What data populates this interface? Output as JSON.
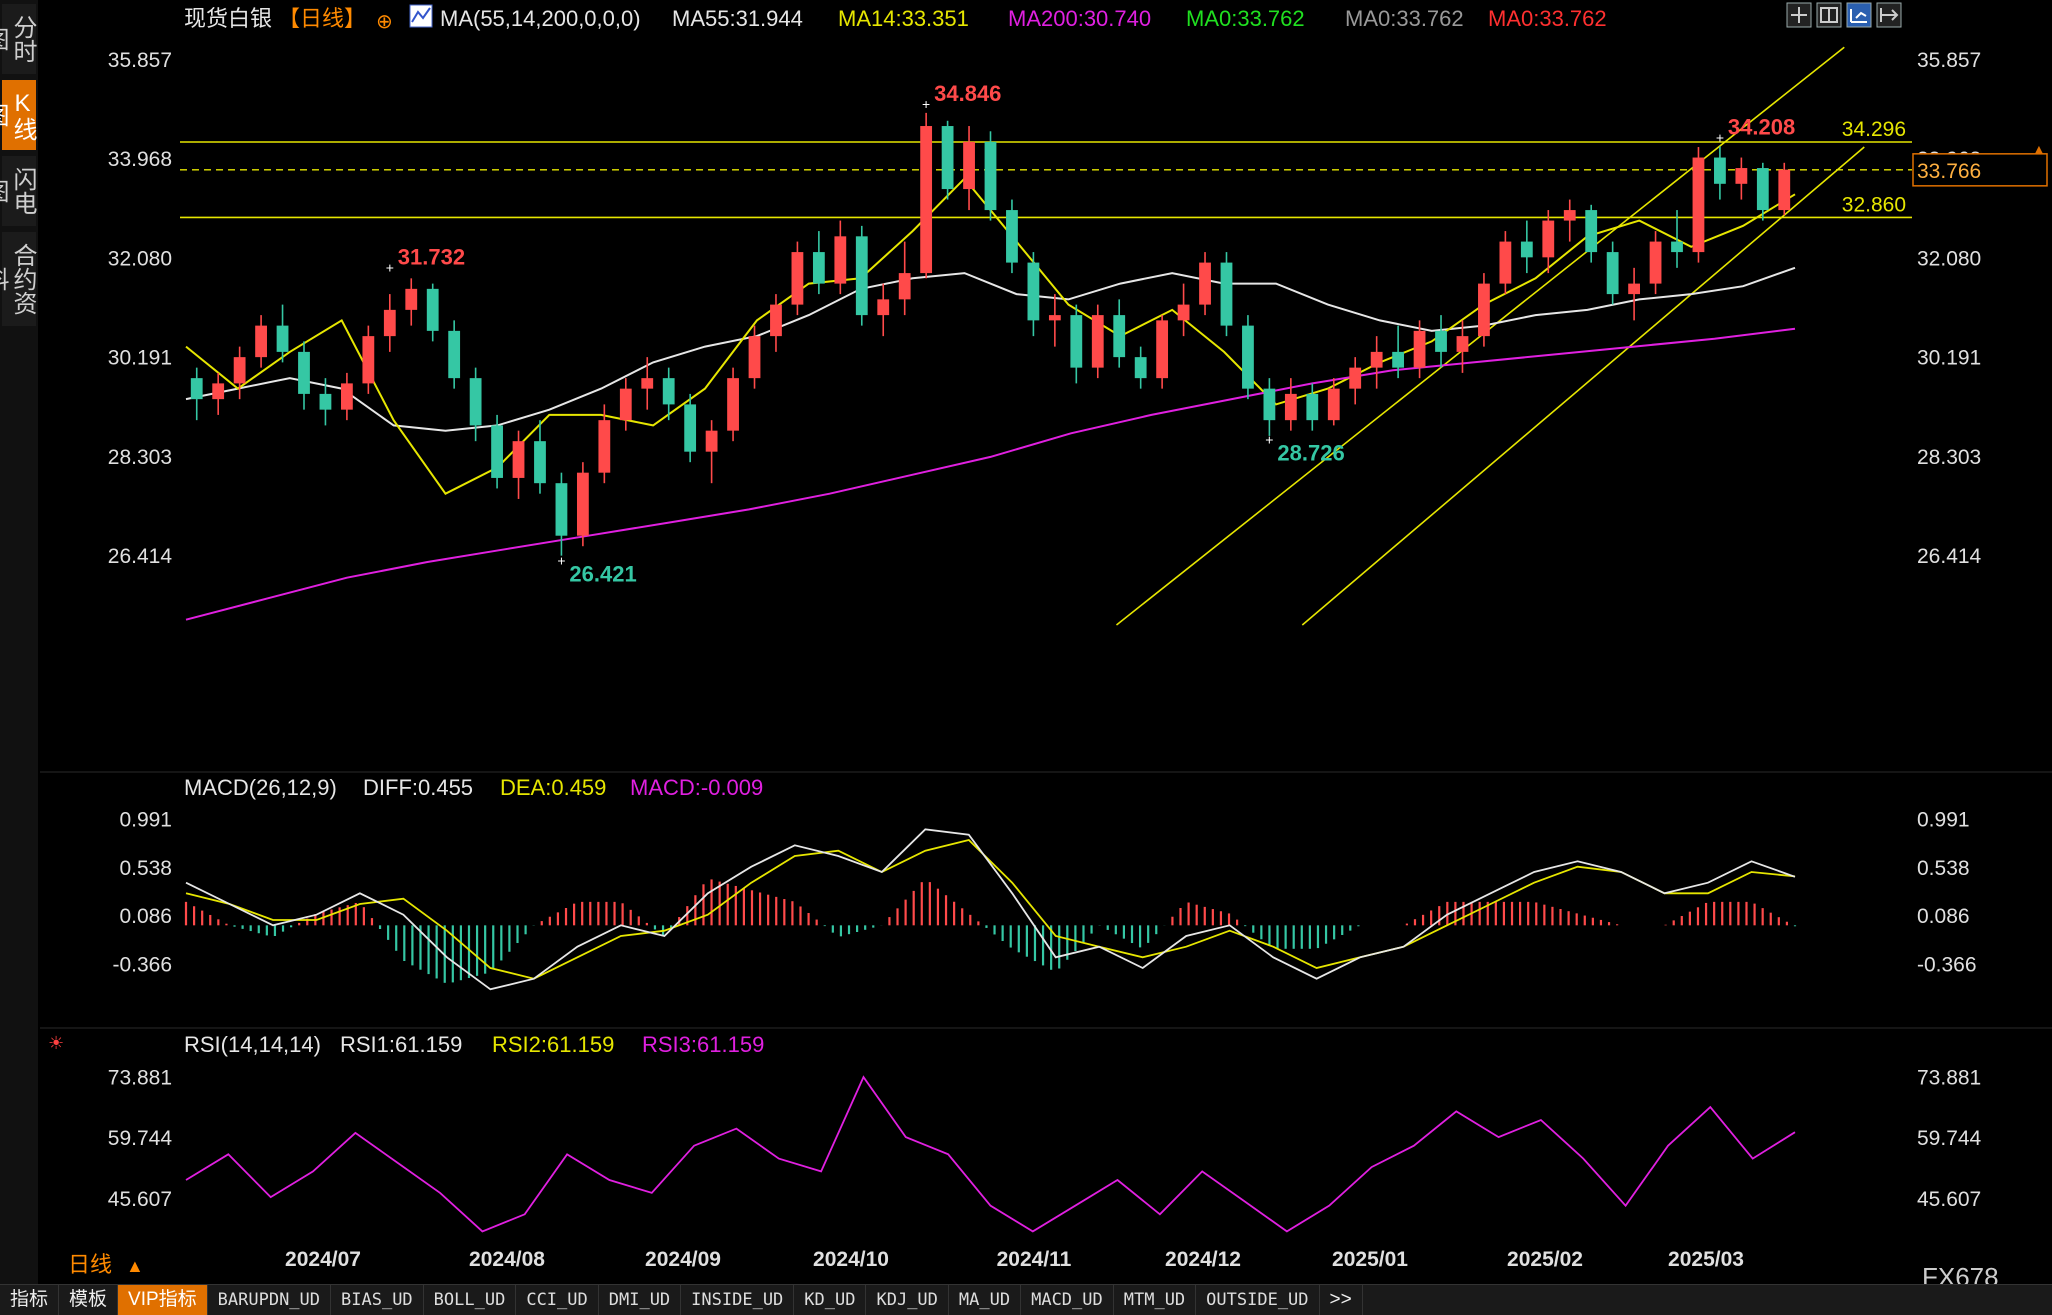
{
  "sidebar": {
    "tabs": [
      {
        "label": "分时图",
        "active": false
      },
      {
        "label": "K线图",
        "active": true
      },
      {
        "label": "闪电图",
        "active": false
      },
      {
        "label": "合约资料",
        "active": false
      }
    ]
  },
  "header": {
    "symbol": "现货白银",
    "period": "【日线】",
    "ma_params": "MA(55,14,200,0,0,0)",
    "ma_values": [
      {
        "label": "MA55:31.944",
        "color": "#e6e6e6"
      },
      {
        "label": "MA14:33.351",
        "color": "#e6e600"
      },
      {
        "label": "MA200:30.740",
        "color": "#e020e0"
      },
      {
        "label": "MA0:33.762",
        "color": "#20e020"
      },
      {
        "label": "MA0:33.762",
        "color": "#999999"
      },
      {
        "label": "MA0:33.762",
        "color": "#ff3030"
      }
    ],
    "toolbar_icons": [
      "grid-icon",
      "layout-icon",
      "chart-type-icon",
      "export-icon"
    ]
  },
  "main_axis": {
    "ticks": [
      "35.857",
      "33.968",
      "32.080",
      "30.191",
      "28.303",
      "26.414"
    ],
    "current_price": "33.766",
    "level_labels": [
      "34.296",
      "32.860"
    ]
  },
  "annotations": [
    "34.846",
    "31.732",
    "26.421",
    "28.726",
    "34.208"
  ],
  "macd": {
    "title": "MACD(26,12,9)",
    "diff": "DIFF:0.455",
    "dea": "DEA:0.459",
    "macd": "MACD:-0.009",
    "ticks": [
      "0.991",
      "0.538",
      "0.086",
      "-0.366"
    ]
  },
  "rsi": {
    "title": "RSI(14,14,14)",
    "rsi1": "RSI1:61.159",
    "rsi2": "RSI2:61.159",
    "rsi3": "RSI3:61.159",
    "ticks": [
      "73.881",
      "59.744",
      "45.607"
    ]
  },
  "date_axis": [
    "2024/07",
    "2024/08",
    "2024/09",
    "2024/10",
    "2024/11",
    "2024/12",
    "2025/01",
    "2025/02",
    "2025/03"
  ],
  "period_selector": "日线",
  "bottom_toolbar": {
    "items": [
      "指标",
      "模板",
      "VIP指标",
      "BARUPDN_UD",
      "BIAS_UD",
      "BOLL_UD",
      "CCI_UD",
      "DMI_UD",
      "INSIDE_UD",
      "KD_UD",
      "KDJ_UD",
      "MA_UD",
      "MACD_UD",
      "MTM_UD",
      "OUTSIDE_UD",
      ">>"
    ]
  },
  "corner_text": "FX678",
  "colors": {
    "up": "#ff4a4a",
    "down": "#35c7a4",
    "ma55": "#e6e6e6",
    "ma14": "#e6e600",
    "ma200": "#e020e0",
    "level_line": "#e6e600",
    "price_tag_border": "#e07000",
    "price_tag_text": "#ffb040"
  },
  "chart_data": {
    "type": "candlestick",
    "price_range": [
      24.7,
      36.2
    ],
    "levels": [
      34.296,
      32.86
    ],
    "current_price": 33.766,
    "series": [
      {
        "name": "MA55",
        "values": [
          29.4,
          29.6,
          29.8,
          29.6,
          28.9,
          28.8,
          28.9,
          29.2,
          29.6,
          30.1,
          30.4,
          30.6,
          31.0,
          31.5,
          31.7,
          31.8,
          31.4,
          31.3,
          31.6,
          31.8,
          31.6,
          31.6,
          31.2,
          30.9,
          30.7,
          30.8,
          31.0,
          31.1,
          31.3,
          31.4,
          31.55,
          31.9
        ]
      },
      {
        "name": "MA14",
        "values": [
          30.4,
          29.6,
          30.3,
          30.9,
          29.0,
          27.6,
          28.1,
          29.1,
          29.1,
          28.9,
          29.6,
          30.9,
          31.6,
          31.7,
          32.6,
          33.6,
          32.4,
          31.2,
          30.6,
          31.1,
          30.3,
          29.3,
          29.6,
          30.1,
          30.5,
          31.2,
          31.7,
          32.5,
          32.8,
          32.3,
          32.7,
          33.3
        ]
      },
      {
        "name": "MA200",
        "values": [
          25.2,
          25.6,
          26.0,
          26.3,
          26.55,
          26.8,
          27.05,
          27.3,
          27.6,
          27.95,
          28.3,
          28.75,
          29.1,
          29.4,
          29.7,
          29.95,
          30.1,
          30.25,
          30.4,
          30.55,
          30.74
        ]
      }
    ],
    "candles": [
      {
        "open": 29.8,
        "high": 30.0,
        "low": 29.0,
        "close": 29.4
      },
      {
        "open": 29.4,
        "high": 29.9,
        "low": 29.1,
        "close": 29.7
      },
      {
        "open": 29.7,
        "high": 30.4,
        "low": 29.4,
        "close": 30.2
      },
      {
        "open": 30.2,
        "high": 31.0,
        "low": 30.0,
        "close": 30.8
      },
      {
        "open": 30.8,
        "high": 31.2,
        "low": 30.1,
        "close": 30.3
      },
      {
        "open": 30.3,
        "high": 30.5,
        "low": 29.2,
        "close": 29.5
      },
      {
        "open": 29.5,
        "high": 29.8,
        "low": 28.9,
        "close": 29.2
      },
      {
        "open": 29.2,
        "high": 29.9,
        "low": 29.0,
        "close": 29.7
      },
      {
        "open": 29.7,
        "high": 30.8,
        "low": 29.5,
        "close": 30.6
      },
      {
        "open": 30.6,
        "high": 31.4,
        "low": 30.3,
        "close": 31.1
      },
      {
        "open": 31.1,
        "high": 31.7,
        "low": 30.8,
        "close": 31.5
      },
      {
        "open": 31.5,
        "high": 31.6,
        "low": 30.5,
        "close": 30.7
      },
      {
        "open": 30.7,
        "high": 30.9,
        "low": 29.6,
        "close": 29.8
      },
      {
        "open": 29.8,
        "high": 30.0,
        "low": 28.6,
        "close": 28.9
      },
      {
        "open": 28.9,
        "high": 29.1,
        "low": 27.7,
        "close": 27.9
      },
      {
        "open": 27.9,
        "high": 28.8,
        "low": 27.5,
        "close": 28.6
      },
      {
        "open": 28.6,
        "high": 29.0,
        "low": 27.6,
        "close": 27.8
      },
      {
        "open": 27.8,
        "high": 28.0,
        "low": 26.42,
        "close": 26.8
      },
      {
        "open": 26.8,
        "high": 28.2,
        "low": 26.6,
        "close": 28.0
      },
      {
        "open": 28.0,
        "high": 29.3,
        "low": 27.8,
        "close": 29.0
      },
      {
        "open": 29.0,
        "high": 29.8,
        "low": 28.8,
        "close": 29.6
      },
      {
        "open": 29.6,
        "high": 30.2,
        "low": 29.2,
        "close": 29.8
      },
      {
        "open": 29.8,
        "high": 30.0,
        "low": 29.0,
        "close": 29.3
      },
      {
        "open": 29.3,
        "high": 29.5,
        "low": 28.2,
        "close": 28.4
      },
      {
        "open": 28.4,
        "high": 29.0,
        "low": 27.8,
        "close": 28.8
      },
      {
        "open": 28.8,
        "high": 30.0,
        "low": 28.6,
        "close": 29.8
      },
      {
        "open": 29.8,
        "high": 30.8,
        "low": 29.6,
        "close": 30.6
      },
      {
        "open": 30.6,
        "high": 31.4,
        "low": 30.3,
        "close": 31.2
      },
      {
        "open": 31.2,
        "high": 32.4,
        "low": 31.0,
        "close": 32.2
      },
      {
        "open": 32.2,
        "high": 32.6,
        "low": 31.4,
        "close": 31.6
      },
      {
        "open": 31.6,
        "high": 32.8,
        "low": 31.4,
        "close": 32.5
      },
      {
        "open": 32.5,
        "high": 32.7,
        "low": 30.8,
        "close": 31.0
      },
      {
        "open": 31.0,
        "high": 31.6,
        "low": 30.6,
        "close": 31.3
      },
      {
        "open": 31.3,
        "high": 32.4,
        "low": 31.0,
        "close": 31.8
      },
      {
        "open": 31.8,
        "high": 34.85,
        "low": 31.7,
        "close": 34.6
      },
      {
        "open": 34.6,
        "high": 34.7,
        "low": 33.2,
        "close": 33.4
      },
      {
        "open": 33.4,
        "high": 34.6,
        "low": 33.0,
        "close": 34.3
      },
      {
        "open": 34.3,
        "high": 34.5,
        "low": 32.8,
        "close": 33.0
      },
      {
        "open": 33.0,
        "high": 33.2,
        "low": 31.8,
        "close": 32.0
      },
      {
        "open": 32.0,
        "high": 32.2,
        "low": 30.6,
        "close": 30.9
      },
      {
        "open": 30.9,
        "high": 31.4,
        "low": 30.4,
        "close": 31.0
      },
      {
        "open": 31.0,
        "high": 31.2,
        "low": 29.7,
        "close": 30.0
      },
      {
        "open": 30.0,
        "high": 31.2,
        "low": 29.8,
        "close": 31.0
      },
      {
        "open": 31.0,
        "high": 31.3,
        "low": 30.0,
        "close": 30.2
      },
      {
        "open": 30.2,
        "high": 30.4,
        "low": 29.6,
        "close": 29.8
      },
      {
        "open": 29.8,
        "high": 31.0,
        "low": 29.6,
        "close": 30.9
      },
      {
        "open": 30.9,
        "high": 31.6,
        "low": 30.6,
        "close": 31.2
      },
      {
        "open": 31.2,
        "high": 32.2,
        "low": 31.0,
        "close": 32.0
      },
      {
        "open": 32.0,
        "high": 32.2,
        "low": 30.6,
        "close": 30.8
      },
      {
        "open": 30.8,
        "high": 31.0,
        "low": 29.4,
        "close": 29.6
      },
      {
        "open": 29.6,
        "high": 29.8,
        "low": 28.7,
        "close": 29.0
      },
      {
        "open": 29.0,
        "high": 29.8,
        "low": 28.8,
        "close": 29.5
      },
      {
        "open": 29.5,
        "high": 29.7,
        "low": 28.8,
        "close": 29.0
      },
      {
        "open": 29.0,
        "high": 29.8,
        "low": 28.9,
        "close": 29.6
      },
      {
        "open": 29.6,
        "high": 30.2,
        "low": 29.3,
        "close": 30.0
      },
      {
        "open": 30.0,
        "high": 30.6,
        "low": 29.6,
        "close": 30.3
      },
      {
        "open": 30.3,
        "high": 30.8,
        "low": 29.8,
        "close": 30.0
      },
      {
        "open": 30.0,
        "high": 30.9,
        "low": 29.8,
        "close": 30.7
      },
      {
        "open": 30.7,
        "high": 31.0,
        "low": 30.0,
        "close": 30.3
      },
      {
        "open": 30.3,
        "high": 30.9,
        "low": 29.9,
        "close": 30.6
      },
      {
        "open": 30.6,
        "high": 31.8,
        "low": 30.4,
        "close": 31.6
      },
      {
        "open": 31.6,
        "high": 32.6,
        "low": 31.4,
        "close": 32.4
      },
      {
        "open": 32.4,
        "high": 32.8,
        "low": 31.8,
        "close": 32.1
      },
      {
        "open": 32.1,
        "high": 33.0,
        "low": 31.8,
        "close": 32.8
      },
      {
        "open": 32.8,
        "high": 33.2,
        "low": 32.4,
        "close": 33.0
      },
      {
        "open": 33.0,
        "high": 33.1,
        "low": 32.0,
        "close": 32.2
      },
      {
        "open": 32.2,
        "high": 32.4,
        "low": 31.2,
        "close": 31.4
      },
      {
        "open": 31.4,
        "high": 31.9,
        "low": 30.9,
        "close": 31.6
      },
      {
        "open": 31.6,
        "high": 32.6,
        "low": 31.4,
        "close": 32.4
      },
      {
        "open": 32.4,
        "high": 33.0,
        "low": 31.9,
        "close": 32.2
      },
      {
        "open": 32.2,
        "high": 34.2,
        "low": 32.0,
        "close": 34.0
      },
      {
        "open": 34.0,
        "high": 34.21,
        "low": 33.2,
        "close": 33.5
      },
      {
        "open": 33.5,
        "high": 34.0,
        "low": 33.2,
        "close": 33.8
      },
      {
        "open": 33.8,
        "high": 33.9,
        "low": 32.8,
        "close": 33.0
      },
      {
        "open": 33.0,
        "high": 33.9,
        "low": 32.9,
        "close": 33.77
      }
    ],
    "macd": {
      "diff": [
        0.4,
        0.2,
        0.0,
        0.1,
        0.3,
        0.1,
        -0.3,
        -0.6,
        -0.5,
        -0.2,
        0.0,
        -0.1,
        0.3,
        0.55,
        0.75,
        0.65,
        0.5,
        0.9,
        0.85,
        0.3,
        -0.3,
        -0.2,
        -0.4,
        -0.1,
        0.0,
        -0.3,
        -0.5,
        -0.3,
        -0.2,
        0.1,
        0.3,
        0.5,
        0.6,
        0.5,
        0.3,
        0.4,
        0.6,
        0.455
      ],
      "dea": [
        0.3,
        0.2,
        0.05,
        0.05,
        0.2,
        0.25,
        -0.05,
        -0.4,
        -0.5,
        -0.3,
        -0.1,
        -0.05,
        0.1,
        0.4,
        0.65,
        0.7,
        0.5,
        0.7,
        0.8,
        0.4,
        -0.1,
        -0.2,
        -0.3,
        -0.2,
        -0.05,
        -0.2,
        -0.4,
        -0.3,
        -0.2,
        0.0,
        0.2,
        0.4,
        0.55,
        0.5,
        0.3,
        0.3,
        0.5,
        0.459
      ]
    },
    "rsi": [
      50,
      56,
      46,
      52,
      61,
      54,
      47,
      38,
      42,
      56,
      50,
      47,
      58,
      62,
      55,
      52,
      74,
      60,
      56,
      44,
      38,
      44,
      50,
      42,
      52,
      45,
      38,
      44,
      53,
      58,
      66,
      60,
      64,
      55,
      44,
      58,
      67,
      55,
      61.159
    ]
  }
}
